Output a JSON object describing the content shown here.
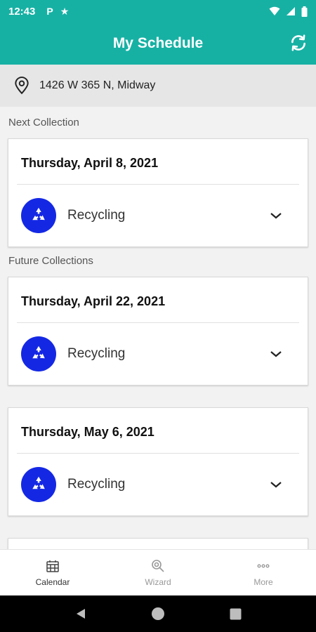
{
  "status": {
    "time": "12:43",
    "icons": [
      "parking-icon",
      "star-icon",
      "wifi-icon",
      "signal-icon",
      "battery-icon"
    ]
  },
  "header": {
    "title": "My Schedule"
  },
  "address": {
    "text": "1426 W 365 N, Midway"
  },
  "sections": {
    "next": "Next Collection",
    "future": "Future Collections"
  },
  "collections": [
    {
      "date": "Thursday, April 8, 2021",
      "material": "Recycling"
    },
    {
      "date": "Thursday, April 22, 2021",
      "material": "Recycling"
    },
    {
      "date": "Thursday, May 6, 2021",
      "material": "Recycling"
    }
  ],
  "nav": [
    {
      "label": "Calendar",
      "active": true
    },
    {
      "label": "Wizard",
      "active": false
    },
    {
      "label": "More",
      "active": false
    }
  ],
  "colors": {
    "primary": "#17b1a4",
    "recycling": "#1428e4"
  }
}
